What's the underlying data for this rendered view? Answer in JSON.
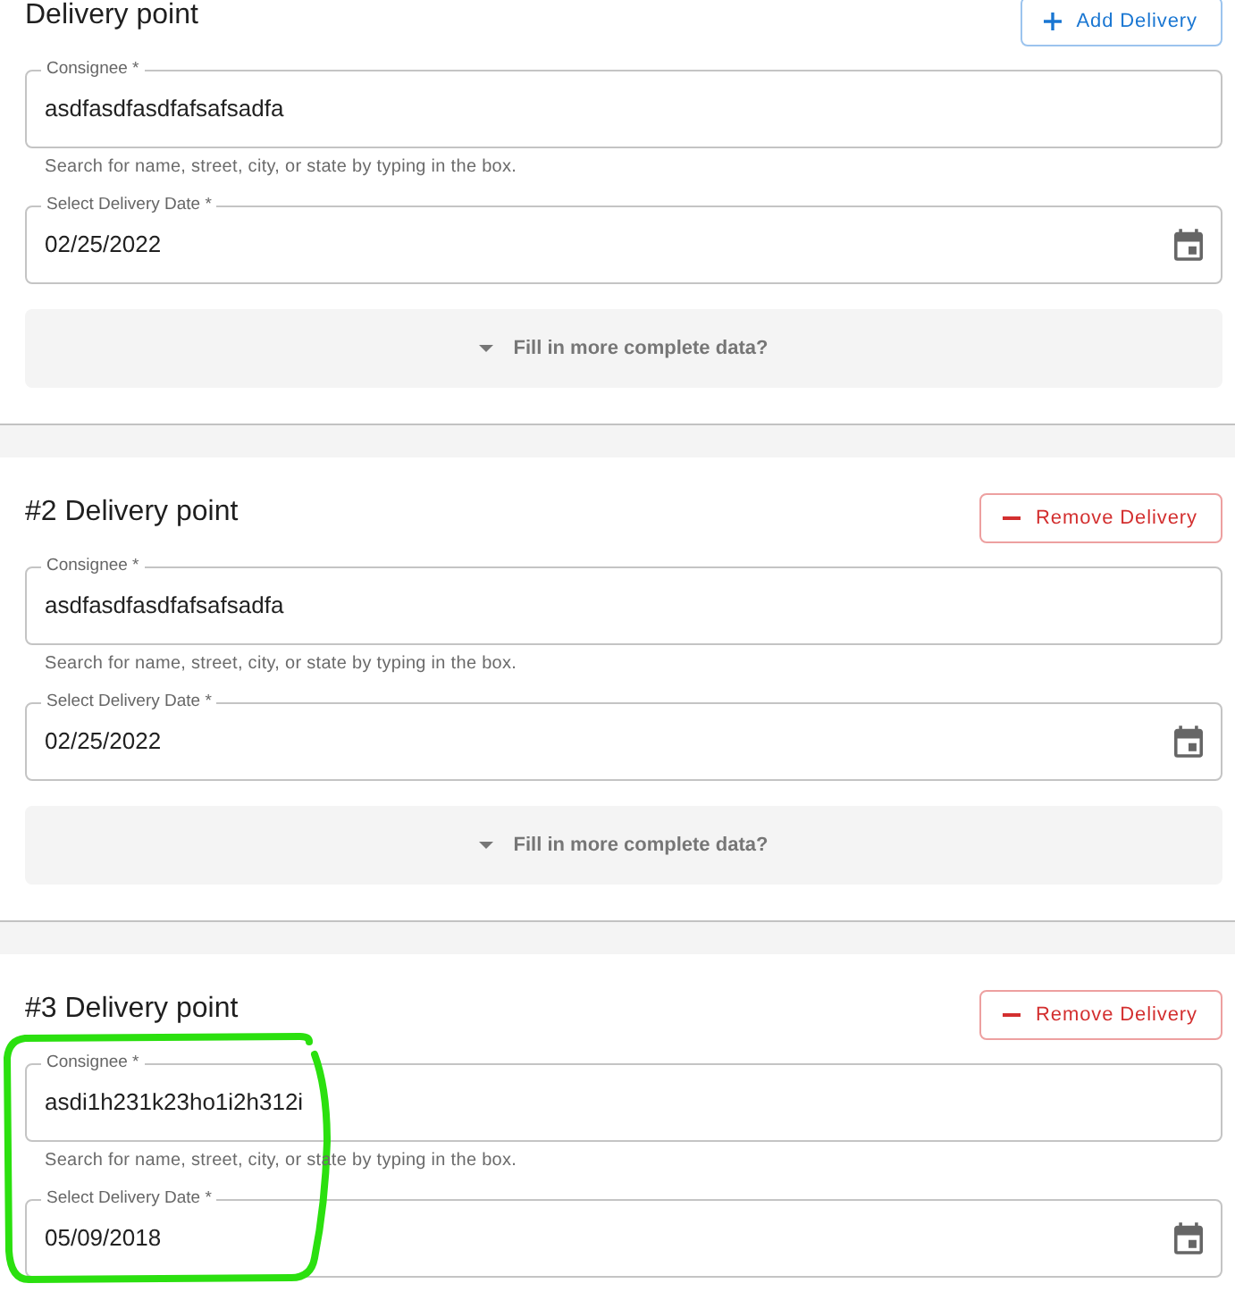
{
  "delivery_points": [
    {
      "title": "Delivery point",
      "action": {
        "kind": "add",
        "label": "Add Delivery"
      },
      "highlighted": false,
      "consignee": {
        "label": "Consignee *",
        "value": "asdfasdfasdfafsafsadfa",
        "helper": "Search for name, street, city, or state by typing in the box."
      },
      "delivery_date": {
        "label": "Select Delivery Date *",
        "value": "02/25/2022"
      },
      "more_data": {
        "label": "Fill in more complete data?",
        "expanded": false
      }
    },
    {
      "title": "#2 Delivery point",
      "action": {
        "kind": "remove",
        "label": "Remove Delivery"
      },
      "highlighted": false,
      "consignee": {
        "label": "Consignee *",
        "value": "asdfasdfasdfafsafsadfa",
        "helper": "Search for name, street, city, or state by typing in the box."
      },
      "delivery_date": {
        "label": "Select Delivery Date *",
        "value": "02/25/2022"
      },
      "more_data": {
        "label": "Fill in more complete data?",
        "expanded": false
      }
    },
    {
      "title": "#3 Delivery point",
      "action": {
        "kind": "remove",
        "label": "Remove Delivery"
      },
      "highlighted": true,
      "consignee": {
        "label": "Consignee *",
        "value": "asdi1h231k23ho1i2h312i",
        "helper": "Search for name, street, city, or state by typing in the box."
      },
      "delivery_date": {
        "label": "Select Delivery Date *",
        "value": "05/09/2018"
      }
    }
  ]
}
